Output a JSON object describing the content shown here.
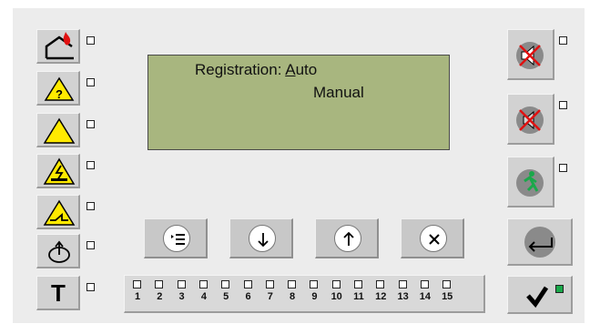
{
  "display": {
    "line1_label": "Registration: ",
    "line1_value_underlined": "A",
    "line1_value_rest": "uto",
    "line2": "Manual"
  },
  "left_buttons": [
    {
      "icon": "fire-alarm-house-icon",
      "led": "off"
    },
    {
      "icon": "fault-unknown-warning-icon",
      "led": "off"
    },
    {
      "icon": "general-warning-icon",
      "led": "off"
    },
    {
      "icon": "electrical-hazard-icon",
      "led": "off"
    },
    {
      "icon": "line-fault-warning-icon",
      "led": "off"
    },
    {
      "icon": "power-icon",
      "led": "off"
    },
    {
      "icon": "test-mode-icon",
      "label": "T",
      "led": "off"
    }
  ],
  "right_buttons": [
    {
      "icon": "sounder-silenced-icon",
      "led": "off"
    },
    {
      "icon": "buzzer-silenced-icon",
      "led": "off"
    },
    {
      "icon": "evacuation-icon",
      "led": "off"
    },
    {
      "icon": "back-return-icon"
    },
    {
      "icon": "confirm-check-icon",
      "led": "on",
      "led_color": "#1aa84a"
    }
  ],
  "nav_buttons": [
    {
      "icon": "menu-icon"
    },
    {
      "icon": "arrow-down-icon"
    },
    {
      "icon": "arrow-up-icon"
    },
    {
      "icon": "cancel-x-icon"
    }
  ],
  "zones": [
    "1",
    "2",
    "3",
    "4",
    "5",
    "6",
    "7",
    "8",
    "9",
    "10",
    "11",
    "12",
    "13",
    "14",
    "15"
  ]
}
